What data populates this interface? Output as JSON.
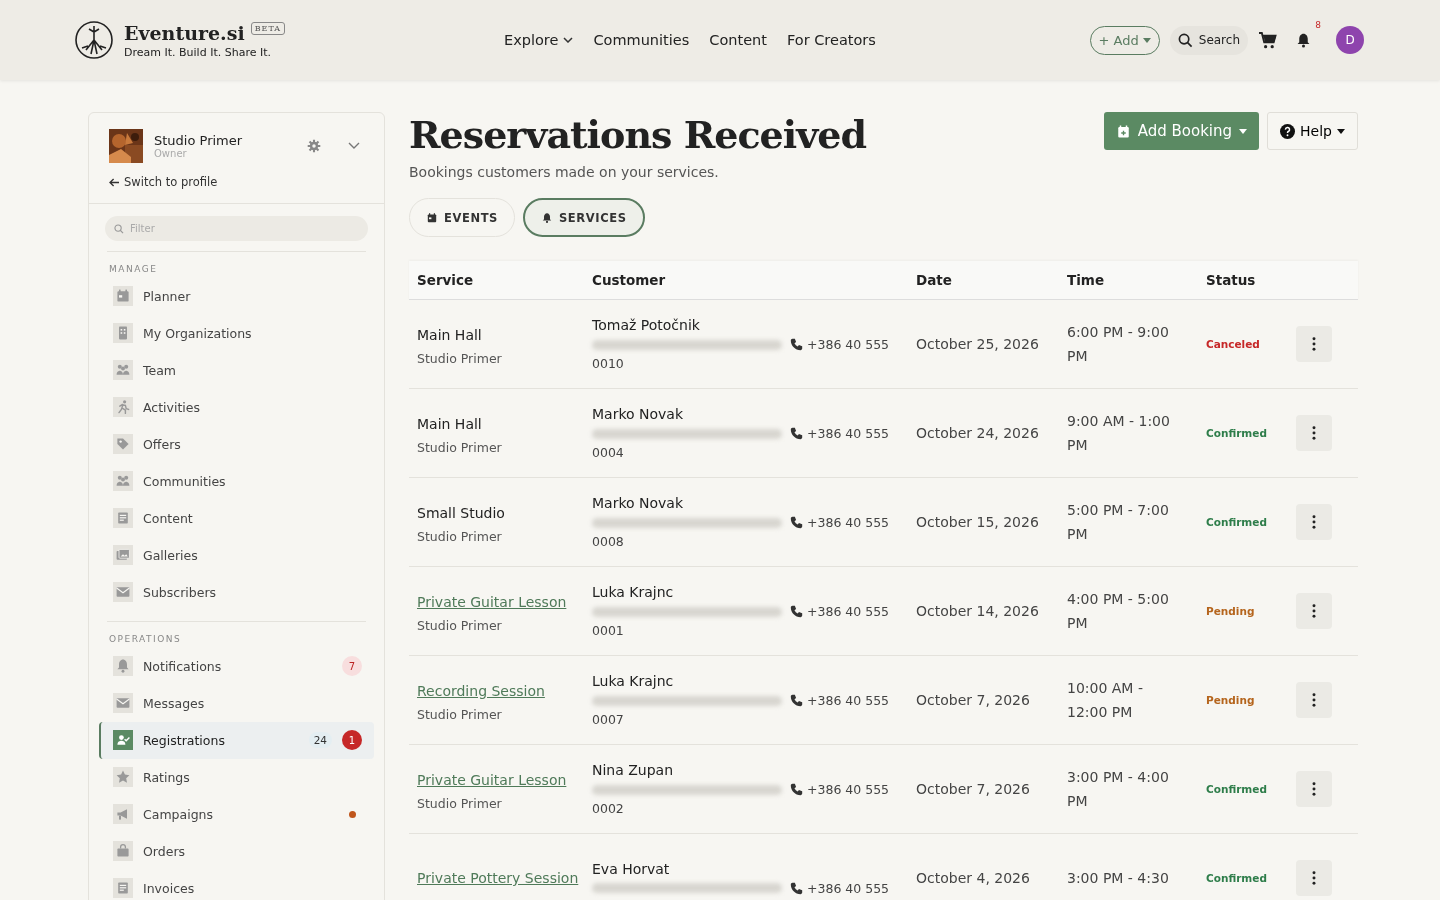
{
  "header": {
    "brand": "Eventure.si",
    "badge": "BETA",
    "tagline": "Dream It. Build It. Share It.",
    "nav": [
      {
        "label": "Explore",
        "dropdown": true
      },
      {
        "label": "Communities",
        "dropdown": false
      },
      {
        "label": "Content",
        "dropdown": false
      },
      {
        "label": "For Creators",
        "dropdown": false
      }
    ],
    "add_button": "+ Add",
    "search": "Search",
    "notifications": "8",
    "avatar": "D"
  },
  "sidebar": {
    "org": {
      "name": "Studio Primer",
      "role": "Owner"
    },
    "switch_link": "Switch to profile",
    "filter": {
      "placeholder": "Filter"
    },
    "sections": [
      {
        "title": "MANAGE",
        "items": [
          {
            "label": "Planner",
            "selected": false
          },
          {
            "label": "My Organizations",
            "selected": false
          },
          {
            "label": "Team",
            "selected": false
          },
          {
            "label": "Activities",
            "selected": false
          },
          {
            "label": "Offers",
            "selected": false
          },
          {
            "label": "Communities",
            "selected": false
          },
          {
            "label": "Content",
            "selected": false
          },
          {
            "label": "Galleries",
            "selected": false
          },
          {
            "label": "Subscribers",
            "selected": false
          }
        ]
      },
      {
        "title": "OPERATIONS",
        "items": [
          {
            "label": "Notifications",
            "selected": false,
            "alert": {
              "label": "7",
              "kind": "soft"
            }
          },
          {
            "label": "Messages",
            "selected": false
          },
          {
            "label": "Registrations",
            "selected": true,
            "count": "24",
            "alert": {
              "label": "1",
              "kind": "strong"
            }
          },
          {
            "label": "Ratings",
            "selected": false
          },
          {
            "label": "Campaigns",
            "selected": false,
            "color": "#c0561c"
          },
          {
            "label": "Orders",
            "selected": false
          },
          {
            "label": "Invoices",
            "selected": false
          }
        ]
      }
    ]
  },
  "page": {
    "title": "Reservations Received",
    "subtitle": "Bookings customers made on your services.",
    "add_booking": "Add Booking",
    "help": "Help",
    "tabs": [
      {
        "label": "EVENTS",
        "selected": false
      },
      {
        "label": "SERVICES",
        "selected": true
      }
    ]
  },
  "table": {
    "columns": [
      "Service",
      "Customer",
      "Date",
      "Time",
      "Status"
    ],
    "rows": [
      {
        "service": "Main Hall",
        "link": false,
        "venue": "Studio Primer",
        "customer": "Tomaž Potočnik",
        "phone": "+386 40 555",
        "code": "0010",
        "date": "October 25, 2026",
        "time": "6:00 PM - 9:00 PM",
        "status": {
          "label": "Canceled",
          "kind": "canceled"
        }
      },
      {
        "service": "Main Hall",
        "link": false,
        "venue": "Studio Primer",
        "customer": "Marko Novak",
        "phone": "+386 40 555",
        "code": "0004",
        "date": "October 24, 2026",
        "time": "9:00 AM - 1:00 PM",
        "status": {
          "label": "Confirmed",
          "kind": "confirmed"
        }
      },
      {
        "service": "Small Studio",
        "link": false,
        "venue": "Studio Primer",
        "customer": "Marko Novak",
        "phone": "+386 40 555",
        "code": "0008",
        "date": "October 15, 2026",
        "time": "5:00 PM - 7:00 PM",
        "status": {
          "label": "Confirmed",
          "kind": "confirmed"
        }
      },
      {
        "service": "Private Guitar Lesson",
        "link": true,
        "venue": "Studio Primer",
        "customer": "Luka Krajnc",
        "phone": "+386 40 555",
        "code": "0001",
        "date": "October 14, 2026",
        "time": "4:00 PM - 5:00 PM",
        "status": {
          "label": "Pending",
          "kind": "pending"
        }
      },
      {
        "service": "Recording Session",
        "link": true,
        "venue": "Studio Primer",
        "customer": "Luka Krajnc",
        "phone": "+386 40 555",
        "code": "0007",
        "date": "October 7, 2026",
        "time": "10:00 AM - 12:00 PM",
        "status": {
          "label": "Pending",
          "kind": "pending"
        }
      },
      {
        "service": "Private Guitar Lesson",
        "link": true,
        "venue": "Studio Primer",
        "customer": "Nina Zupan",
        "phone": "+386 40 555",
        "code": "0002",
        "date": "October 7, 2026",
        "time": "3:00 PM - 4:00 PM",
        "status": {
          "label": "Confirmed",
          "kind": "confirmed"
        }
      },
      {
        "service": "Private Pottery Session",
        "link": true,
        "customer": "Eva Horvat",
        "phone": "+386 40 555",
        "date": "October 4, 2026",
        "time": "3:00 PM - 4:30",
        "status": {
          "label": "Confirmed",
          "kind": "confirmed"
        }
      }
    ]
  }
}
